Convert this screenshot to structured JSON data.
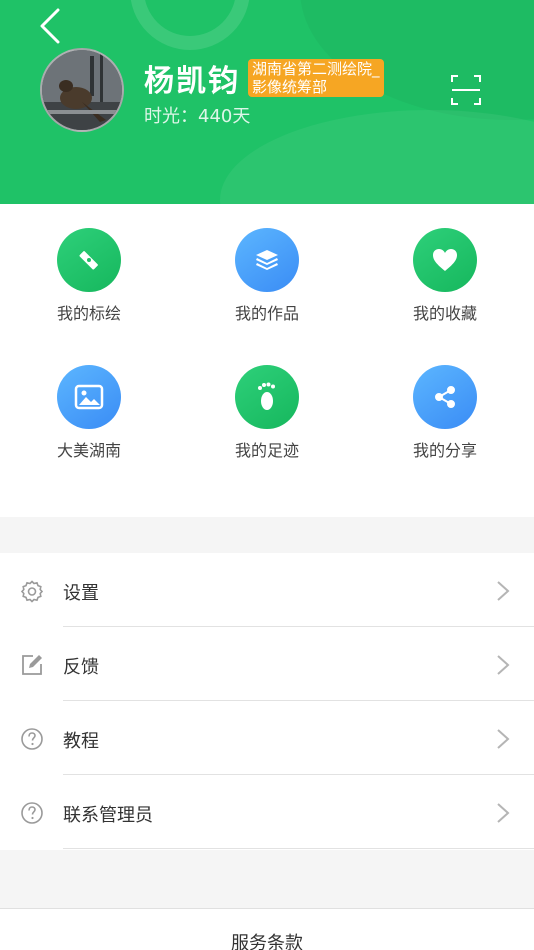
{
  "header": {
    "username": "杨凯钧",
    "org_badge": "湖南省第二测绘院_影像统筹部",
    "time_text": "时光：440天",
    "back_icon": "chevron-left-icon",
    "scan_icon": "scan-icon"
  },
  "grid": {
    "items": [
      {
        "label": "我的标绘",
        "icon": "pencil-ruler-icon",
        "color": "#1fc267"
      },
      {
        "label": "我的作品",
        "icon": "layers-icon",
        "color": "#3a8cf5"
      },
      {
        "label": "我的收藏",
        "icon": "heart-icon",
        "color": "#1fc267"
      },
      {
        "label": "大美湖南",
        "icon": "image-icon",
        "color": "#3a8cf5"
      },
      {
        "label": "我的足迹",
        "icon": "footprint-icon",
        "color": "#1fc267"
      },
      {
        "label": "我的分享",
        "icon": "share-icon",
        "color": "#3a8cf5"
      }
    ]
  },
  "menu": {
    "items": [
      {
        "label": "设置",
        "icon": "gear-icon"
      },
      {
        "label": "反馈",
        "icon": "edit-icon"
      },
      {
        "label": "教程",
        "icon": "help-circle-icon"
      },
      {
        "label": "联系管理员",
        "icon": "help-circle-icon"
      }
    ]
  },
  "footer": {
    "terms": "服务条款"
  },
  "colors": {
    "header_green": "#1fc267",
    "badge_orange": "#f6a623",
    "icon_blue": "#3a8cf5"
  }
}
